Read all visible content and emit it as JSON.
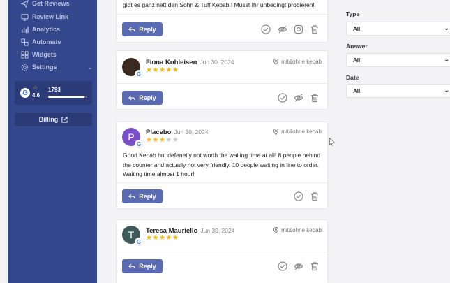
{
  "sidebar": {
    "items": [
      {
        "label": "Get Reviews",
        "icon": "send-icon"
      },
      {
        "label": "Review Link",
        "icon": "monitor-icon"
      },
      {
        "label": "Analytics",
        "icon": "bar-chart-icon"
      },
      {
        "label": "Automate",
        "icon": "automate-icon"
      },
      {
        "label": "Widgets",
        "icon": "widgets-icon"
      },
      {
        "label": "Settings",
        "icon": "gear-icon",
        "chevron": "⌄"
      }
    ],
    "rating": {
      "value": "4.6",
      "count": "1793",
      "progress_fraction": 0.92
    },
    "billing_label": "Billing"
  },
  "reviews": [
    {
      "text_partial": "gibt es ganz nett den Sohn & Tuff Kebab!! Musst Ihr unbedingt probieren!",
      "reply_label": "Reply"
    },
    {
      "author": "Fiona Kohleisen",
      "date": "Jun 30, 2024",
      "rating": 5,
      "location": "mit&ohne kebab",
      "avatar_color": "#3a2a22",
      "reply_label": "Reply"
    },
    {
      "author": "Placebo",
      "date": "Jun 30, 2024",
      "rating": 3,
      "location": "mit&ohne kebab",
      "avatar_letter": "P",
      "avatar_color": "#7b4fc9",
      "text": "Good Kebab but defenetly not worth the waiting time at all! 8 people behind the counter and actually not very friendly. 10 people waiting in line to order. Waiting time almost 1 hour!",
      "reply_label": "Reply"
    },
    {
      "author": "Teresa Mauriello",
      "date": "Jun 30, 2024",
      "rating": 5,
      "location": "mit&ohne kebab",
      "avatar_letter": "T",
      "avatar_color": "#3f5a5a",
      "reply_label": "Reply"
    }
  ],
  "filters": {
    "type": {
      "label": "Type",
      "value": "All"
    },
    "answer": {
      "label": "Answer",
      "value": "All"
    },
    "date": {
      "label": "Date",
      "value": "All"
    }
  },
  "colors": {
    "sidebar": "#34478c",
    "accent": "#5a6bb3",
    "star": "#f5b90c"
  },
  "google_letter": "G",
  "billing_icon": "external-link-icon"
}
